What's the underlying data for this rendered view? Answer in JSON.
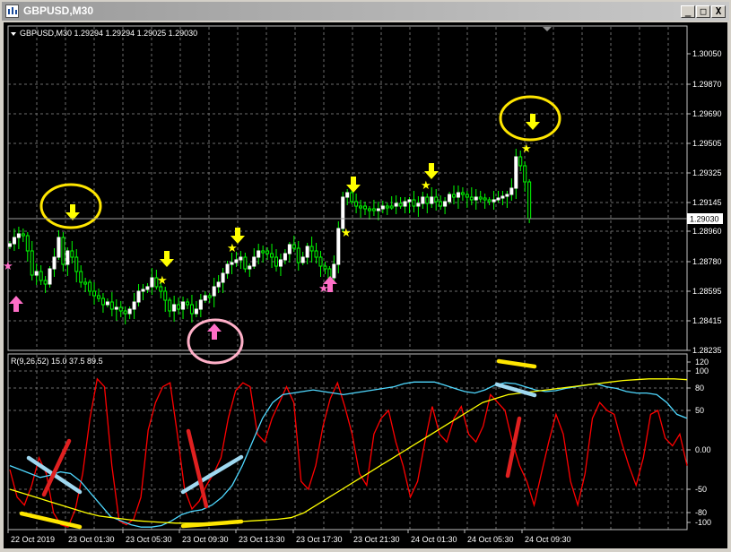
{
  "window": {
    "title": "GBPUSD,M30",
    "buttons": [
      "_",
      "□",
      "X"
    ]
  },
  "price_panel": {
    "header": "GBPUSD,M30  1.29294 1.29294 1.29025 1.29030",
    "price_labels": [
      "1.30050",
      "1.29870",
      "1.29690",
      "1.29505",
      "1.29325",
      "1.29145",
      "1.28960",
      "1.28780",
      "1.28595",
      "1.28415",
      "1.28235"
    ],
    "current_price": "1.29030",
    "colors": {
      "background": "#000000",
      "bull": "#ffffff",
      "bear": "#00ff00",
      "grid": "#6b6b6b",
      "up_arrow": "#ff6ec7",
      "down_arrow": "#ffff00"
    }
  },
  "indicator_panel": {
    "header": "R(9,26,52) 15.0 37.5 89.5",
    "levels": [
      "120",
      "100",
      "80",
      "50",
      "0.00",
      "-50",
      "-80",
      "-100"
    ],
    "colors": {
      "fast": "#ff0000",
      "medium": "#4fd8ff",
      "slow": "#ffff00"
    }
  },
  "time_axis": {
    "labels": [
      "22 Oct 2019",
      "23 Oct 01:30",
      "23 Oct 05:30",
      "23 Oct 09:30",
      "23 Oct 13:30",
      "23 Oct 17:30",
      "23 Oct 21:30",
      "24 Oct 01:30",
      "24 Oct 05:30",
      "24 Oct 09:30"
    ]
  }
}
